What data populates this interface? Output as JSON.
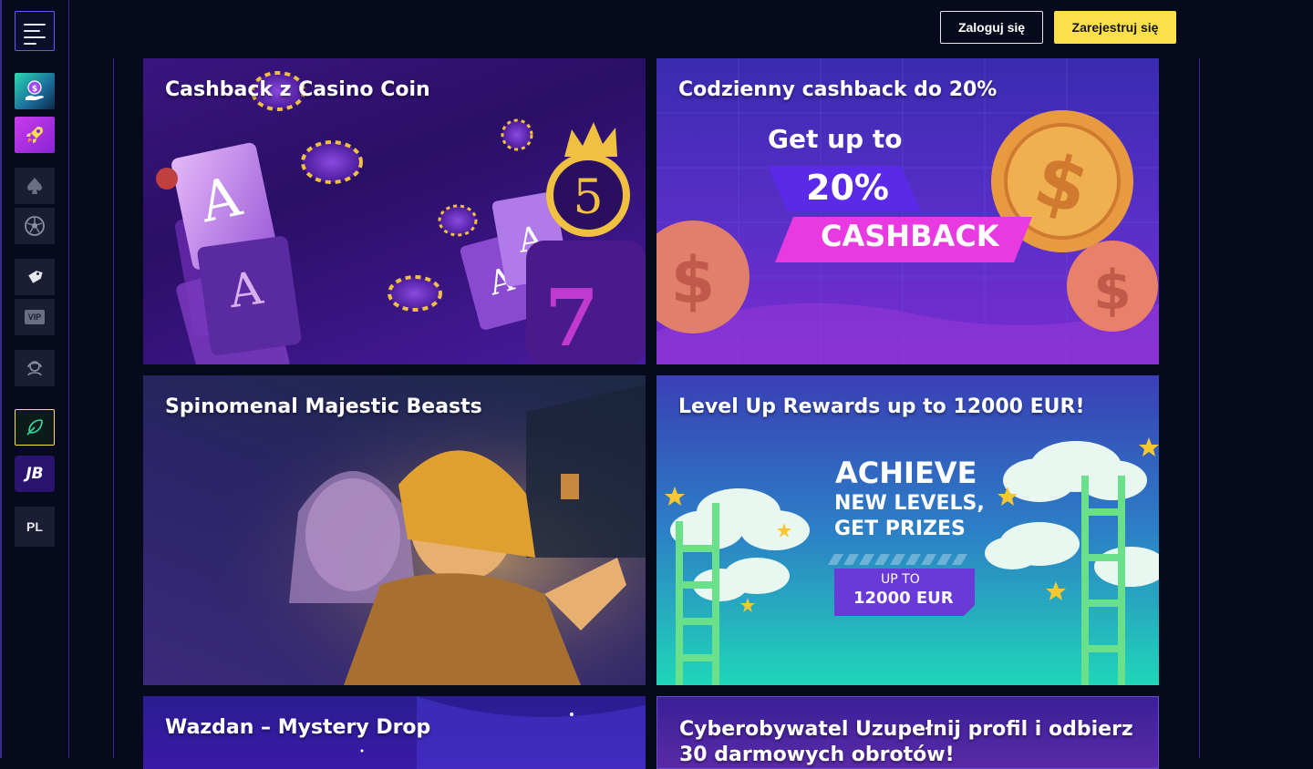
{
  "header": {
    "login_label": "Zaloguj się",
    "register_label": "Zarejestruj się"
  },
  "sidebar": {
    "items": [
      {
        "icon": "coin-hand-icon"
      },
      {
        "icon": "rocket-icon"
      },
      {
        "icon": "spade-icon"
      },
      {
        "icon": "football-icon"
      },
      {
        "icon": "tag-icon"
      },
      {
        "icon": "vip-icon",
        "label": "VIP"
      },
      {
        "icon": "support-agent-icon"
      },
      {
        "icon": "leaf-rocket-icon"
      },
      {
        "icon": "jb-logo-icon",
        "label": "JB"
      }
    ],
    "language": "PL"
  },
  "promotions": [
    {
      "title": "Cashback z Casino Coin"
    },
    {
      "title": "Codzienny cashback do 20%",
      "art_lines": [
        "Get up to",
        "20%",
        "CASHBACK"
      ]
    },
    {
      "title": "Spinomenal Majestic Beasts"
    },
    {
      "title": "Level Up Rewards up to 12000 EUR!",
      "art_lines": [
        "ACHIEVE",
        "NEW LEVELS,",
        "GET PRIZES",
        "UP TO",
        "12000 EUR"
      ]
    },
    {
      "title": "Wazdan – Mystery Drop"
    },
    {
      "title": "Cyberobywatel Uzupełnij profil i odbierz 30 darmowych obrotów!"
    }
  ],
  "colors": {
    "accent": "#fbe04c",
    "sidebar_border": "#3a2c8c",
    "background": "#070a1c"
  }
}
